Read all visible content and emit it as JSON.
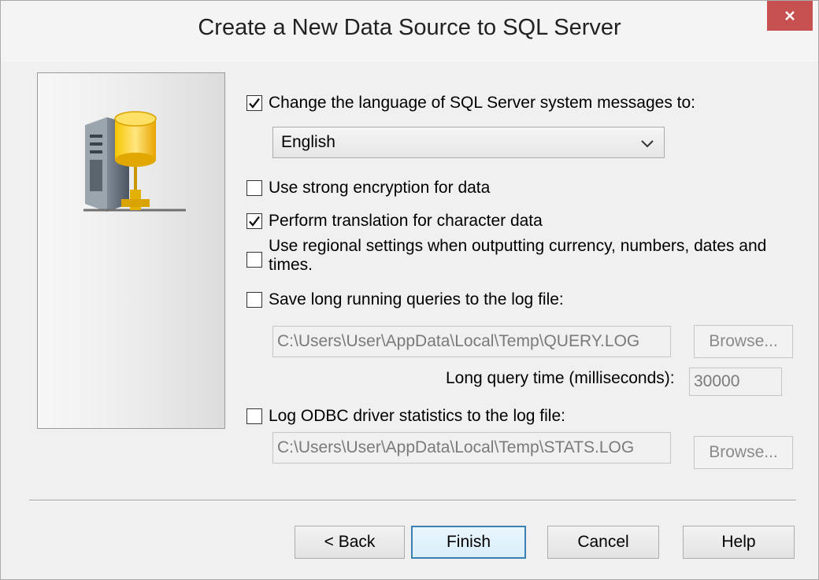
{
  "window": {
    "title": "Create a New Data Source to SQL Server"
  },
  "icons": {
    "close": "close-icon",
    "server": "server-database-icon",
    "chevron": "chevron-down-icon",
    "check": "checkmark-icon"
  },
  "options": {
    "change_language": {
      "label": "Change the language of SQL Server system messages to:",
      "checked": true
    },
    "language_select": {
      "value": "English"
    },
    "strong_encryption": {
      "label": "Use strong encryption for data",
      "checked": false
    },
    "translation": {
      "label": "Perform translation for character data",
      "checked": true
    },
    "regional_settings": {
      "label_line1": "Use regional settings when outputting currency, numbers, dates and",
      "label_line2": "times.",
      "checked": false
    },
    "save_long_queries": {
      "label": "Save long running queries to the log file:",
      "checked": false
    },
    "query_log_path": "C:\\Users\\User\\AppData\\Local\\Temp\\QUERY.LOG",
    "query_browse": "Browse...",
    "long_query_time_label": "Long query time (milliseconds):",
    "long_query_time_value": "30000",
    "log_odbc_stats": {
      "label": "Log ODBC driver statistics to the log file:",
      "checked": false
    },
    "stats_log_path": "C:\\Users\\User\\AppData\\Local\\Temp\\STATS.LOG",
    "stats_browse": "Browse..."
  },
  "buttons": {
    "back": "< Back",
    "finish": "Finish",
    "cancel": "Cancel",
    "help": "Help"
  },
  "colors": {
    "close_bg": "#c75050",
    "default_border": "#3c7fb1"
  }
}
